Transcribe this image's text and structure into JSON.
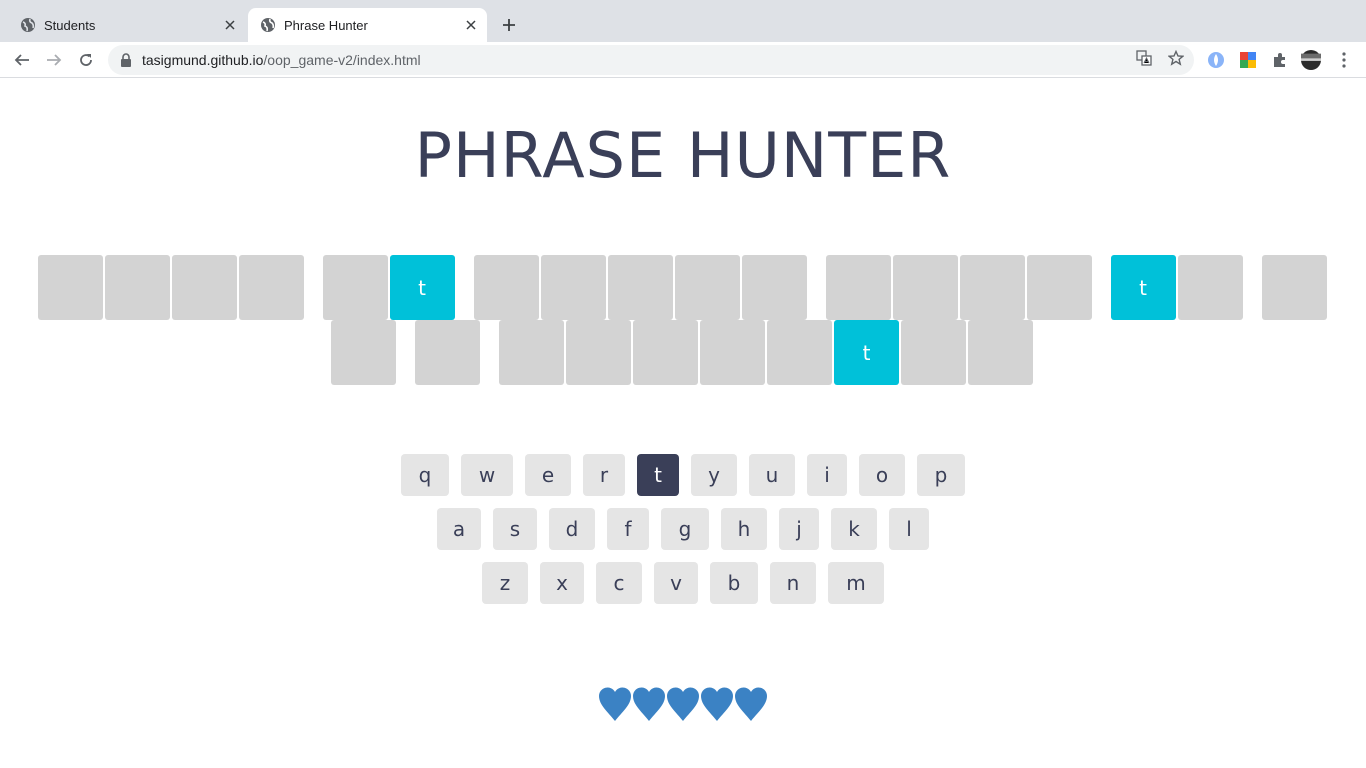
{
  "browser": {
    "tabs": [
      {
        "title": "Students",
        "active": false
      },
      {
        "title": "Phrase Hunter",
        "active": true
      }
    ],
    "url_host": "tasigmund.github.io",
    "url_path": "/oop_game-v2/index.html"
  },
  "game": {
    "title": "PHRASE HUNTER",
    "phrase_rows": [
      [
        {
          "type": "letter",
          "char": "",
          "shown": false
        },
        {
          "type": "letter",
          "char": "",
          "shown": false
        },
        {
          "type": "letter",
          "char": "",
          "shown": false
        },
        {
          "type": "letter",
          "char": "",
          "shown": false
        },
        {
          "type": "space"
        },
        {
          "type": "letter",
          "char": "",
          "shown": false
        },
        {
          "type": "letter",
          "char": "t",
          "shown": true
        },
        {
          "type": "space"
        },
        {
          "type": "letter",
          "char": "",
          "shown": false
        },
        {
          "type": "letter",
          "char": "",
          "shown": false
        },
        {
          "type": "letter",
          "char": "",
          "shown": false
        },
        {
          "type": "letter",
          "char": "",
          "shown": false
        },
        {
          "type": "letter",
          "char": "",
          "shown": false
        },
        {
          "type": "space"
        },
        {
          "type": "letter",
          "char": "",
          "shown": false
        },
        {
          "type": "letter",
          "char": "",
          "shown": false
        },
        {
          "type": "letter",
          "char": "",
          "shown": false
        },
        {
          "type": "letter",
          "char": "",
          "shown": false
        },
        {
          "type": "space"
        },
        {
          "type": "letter",
          "char": "t",
          "shown": true
        },
        {
          "type": "letter",
          "char": "",
          "shown": false
        },
        {
          "type": "space"
        },
        {
          "type": "letter",
          "char": "",
          "shown": false
        }
      ],
      [
        {
          "type": "letter",
          "char": "",
          "shown": false
        },
        {
          "type": "space"
        },
        {
          "type": "letter",
          "char": "",
          "shown": false
        },
        {
          "type": "space"
        },
        {
          "type": "letter",
          "char": "",
          "shown": false
        },
        {
          "type": "letter",
          "char": "",
          "shown": false
        },
        {
          "type": "letter",
          "char": "",
          "shown": false
        },
        {
          "type": "letter",
          "char": "",
          "shown": false
        },
        {
          "type": "letter",
          "char": "",
          "shown": false
        },
        {
          "type": "letter",
          "char": "t",
          "shown": true
        },
        {
          "type": "letter",
          "char": "",
          "shown": false
        },
        {
          "type": "letter",
          "char": "",
          "shown": false
        }
      ]
    ],
    "keyboard": [
      [
        "q",
        "w",
        "e",
        "r",
        "t",
        "y",
        "u",
        "i",
        "o",
        "p"
      ],
      [
        "a",
        "s",
        "d",
        "f",
        "g",
        "h",
        "j",
        "k",
        "l"
      ],
      [
        "z",
        "x",
        "c",
        "v",
        "b",
        "n",
        "m"
      ]
    ],
    "chosen_keys": [
      "t"
    ],
    "lives_remaining": 5,
    "heart_color": "#3b82c4",
    "tile_reveal_color": "#00c1d9",
    "tile_hidden_color": "#d3d3d3",
    "key_chosen_color": "#3a3f58"
  }
}
